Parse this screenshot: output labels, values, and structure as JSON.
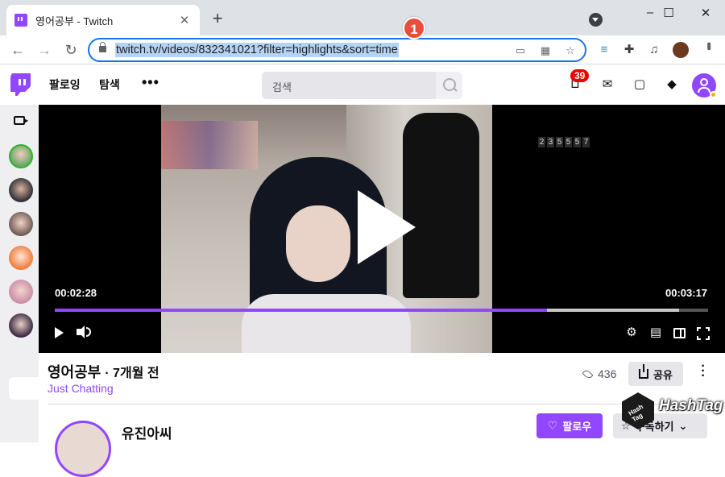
{
  "browser": {
    "tab_title": "영어공부 - Twitch",
    "tab_close": "✕",
    "new_tab": "+",
    "window_controls": {
      "minimize": "–",
      "maximize": "☐",
      "close": "✕"
    },
    "url": "twitch.tv/videos/832341021?filter=highlights&sort=time",
    "step_badge": "1"
  },
  "nav": {
    "following": "팔로잉",
    "browse": "탐색",
    "more": "•••",
    "search_placeholder": "검색",
    "notification_count": "39"
  },
  "video": {
    "time_current": "00:02:28",
    "time_total": "00:03:17",
    "progress": 0.753,
    "buffered": 0.955,
    "overlay_clock": [
      "2",
      "3",
      "5",
      "5",
      "5",
      "7"
    ]
  },
  "info": {
    "title": "영어공부",
    "age": "· 7개월 전",
    "category": "Just Chatting",
    "views": "436",
    "share_label": "공유",
    "channel_name": "유진아씨",
    "follow_label": "팔로우",
    "subscribe_label": "구독하기"
  },
  "watermark": {
    "text": "HashTag",
    "cube_text": "Hash Tag"
  },
  "colors": {
    "twitch_purple": "#9147ff",
    "chrome_focus": "#1a73e8",
    "badge_red": "#eb0400"
  }
}
